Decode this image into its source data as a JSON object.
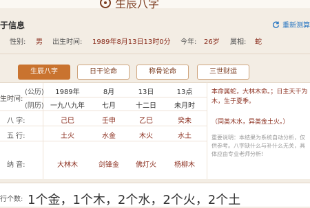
{
  "header": {
    "logo_text": "生辰八字"
  },
  "section": {
    "title": "于信息",
    "reset_label": "重新测算"
  },
  "info": {
    "gender_label": "性别:",
    "gender": "男",
    "birth_label": "出生时间:",
    "birth": "1989年8月13日13时0分",
    "year_label": "今年:",
    "age": "26岁",
    "zodiac_label": "属相:",
    "zodiac": "蛇"
  },
  "tabs": [
    {
      "label": "生辰八字",
      "active": true
    },
    {
      "label": "日干论命",
      "active": false
    },
    {
      "label": "称骨论命",
      "active": false
    },
    {
      "label": "三世财运",
      "active": false
    }
  ],
  "chart": {
    "birth_label": "生时间:",
    "gregorian_label": "(公历)",
    "lunar_label": "(阴历)",
    "gregorian": [
      "1989年",
      "8月",
      "13日",
      "13点"
    ],
    "lunar": [
      "一九八九年",
      "七月",
      "十二日",
      "未月时"
    ],
    "bazi_label": "八 字:",
    "bazi": [
      "己巳",
      "壬申",
      "乙巳",
      "癸未"
    ],
    "wuxing_label": "五 行:",
    "wuxing": [
      "土火",
      "水金",
      "木火",
      "水土"
    ],
    "nayin_label": "纳 音:",
    "nayin": [
      "大林木",
      "剑锋金",
      "佛灯火",
      "杨柳木"
    ]
  },
  "analysis": {
    "text": "本命属蛇，大林木命。；日主天干为木，生于夏季。",
    "sub": "（同类木水，异类金土火。）",
    "note": "重要说明：本结果为系统自动分析，仅供参考。八字缺什么与补什么无关，具体应由专业老师分析!"
  },
  "summary": {
    "label": "行个数:",
    "value": "1个金，1个木，2个水，2个火，2个土"
  }
}
